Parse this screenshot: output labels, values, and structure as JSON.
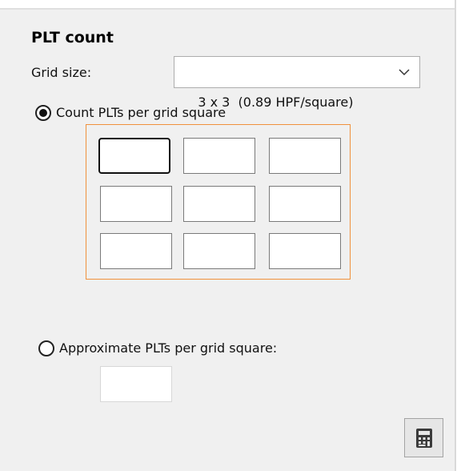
{
  "panel": {
    "title": "PLT count"
  },
  "grid_size": {
    "label": "Grid size:",
    "selected": "3 x 3  (0.89 HPF/square)"
  },
  "options": {
    "count_per_square": {
      "label": "Count PLTs per grid square",
      "checked": true
    },
    "approximate": {
      "label": "Approximate PLTs per grid square:",
      "checked": false,
      "value": ""
    }
  },
  "grid": {
    "rows": 3,
    "cols": 3,
    "cells": [
      [
        "",
        "",
        ""
      ],
      [
        "",
        "",
        ""
      ],
      [
        "",
        "",
        ""
      ]
    ]
  },
  "icons": {
    "dropdown": "chevron-down-icon",
    "calculate": "calculator-icon"
  },
  "colors": {
    "grid_border": "#f0913c",
    "background": "#f0f0f0"
  }
}
